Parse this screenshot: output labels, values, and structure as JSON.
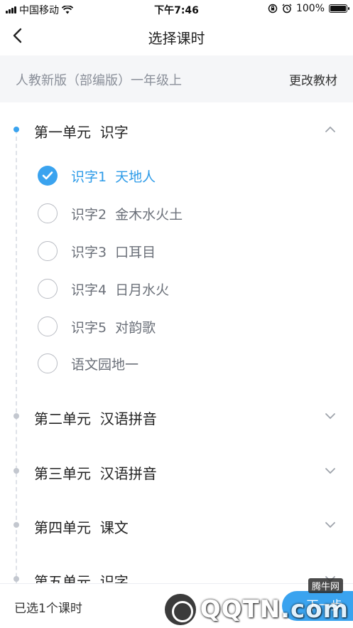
{
  "status_bar": {
    "carrier": "中国移动",
    "time": "下午7:46",
    "battery": "100%",
    "battery_level": 1.0
  },
  "nav": {
    "title": "选择课时"
  },
  "textbook": {
    "name": "人教新版（部编版）一年级上",
    "change_label": "更改教材"
  },
  "units": [
    {
      "label": "第一单元  识字",
      "expanded": true,
      "lessons": [
        {
          "label": "识字1  天地人",
          "selected": true
        },
        {
          "label": "识字2  金木水火土",
          "selected": false
        },
        {
          "label": "识字3  口耳目",
          "selected": false
        },
        {
          "label": "识字4  日月水火",
          "selected": false
        },
        {
          "label": "识字5  对韵歌",
          "selected": false
        },
        {
          "label": "语文园地一",
          "selected": false
        }
      ]
    },
    {
      "label": "第二单元  汉语拼音",
      "expanded": false
    },
    {
      "label": "第三单元  汉语拼音",
      "expanded": false
    },
    {
      "label": "第四单元  课文",
      "expanded": false
    },
    {
      "label": "第五单元  识字",
      "expanded": false
    }
  ],
  "bottom": {
    "selected_text": "已选1个课时",
    "button_label": "下一步"
  },
  "watermark": {
    "text": "QQTN.com",
    "sub": "腾牛网"
  },
  "colors": {
    "accent": "#3aa3ef",
    "selected_text": "#2d9be8",
    "muted_text": "#6b7079",
    "book_bar_bg": "#f5f6f8"
  }
}
